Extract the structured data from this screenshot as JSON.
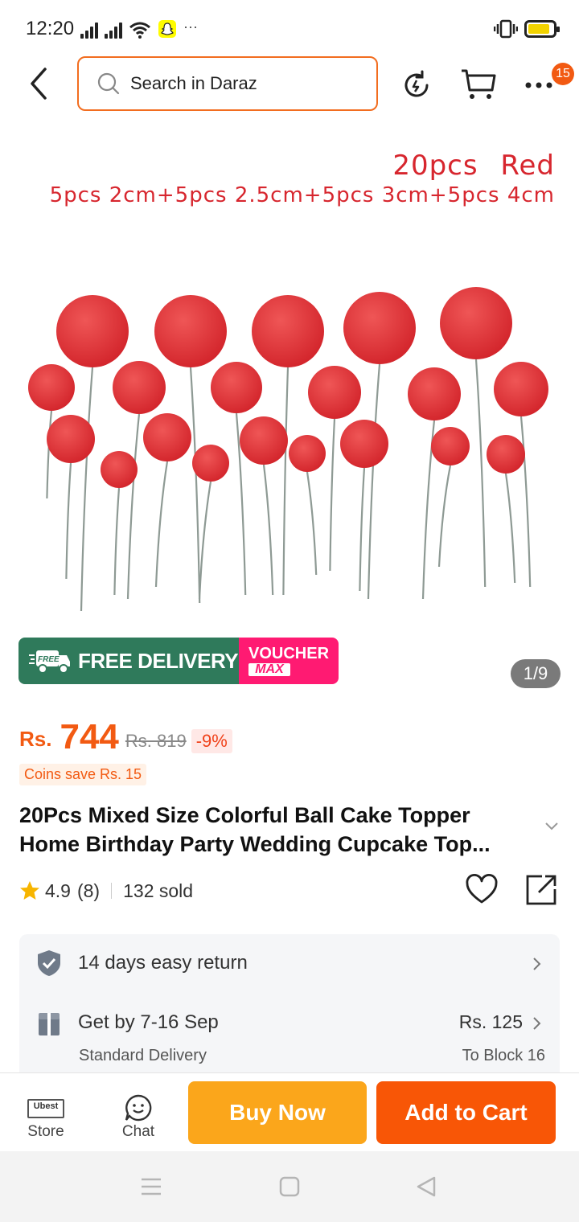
{
  "status_bar": {
    "time": "12:20",
    "more": "···"
  },
  "header": {
    "search_placeholder": "Search in Daraz",
    "cart_badge": "15"
  },
  "product_image": {
    "line1": "20pcs   Red",
    "line2": "5pcs 2cm+5pcs 2.5cm+5pcs 3cm+5pcs 4cm",
    "ball_color": "#d2232a",
    "promo_free_tag": "FREE",
    "promo_free_label": "FREE DELIVERY",
    "promo_voucher_1": "VOUCHER",
    "promo_voucher_2": "MAX",
    "page_indicator": "1/9"
  },
  "price": {
    "currency": "Rs.",
    "current": "744",
    "original": "Rs. 819",
    "discount": "-9%",
    "coins": "Coins save Rs. 15"
  },
  "product": {
    "title_line1": "20Pcs Mixed Size Colorful Ball Cake Topper",
    "title_line2": "Home Birthday Party Wedding Cupcake Top...",
    "rating": "4.9",
    "reviews": "(8)",
    "sold": "132 sold"
  },
  "service": {
    "return": "14 days easy return",
    "delivery": "Get by 7-16 Sep",
    "delivery_type": "Standard Delivery",
    "delivery_fee": "Rs. 125",
    "delivery_to": "To Block 16"
  },
  "action_bar": {
    "store_logo": "Ubest",
    "store": "Store",
    "chat": "Chat",
    "buy_now": "Buy Now",
    "add_to_cart": "Add to Cart"
  },
  "colors": {
    "accent": "#f85606",
    "buy": "#fba61b",
    "free_delivery": "#2f7a5b",
    "voucher": "#ff1a72"
  }
}
